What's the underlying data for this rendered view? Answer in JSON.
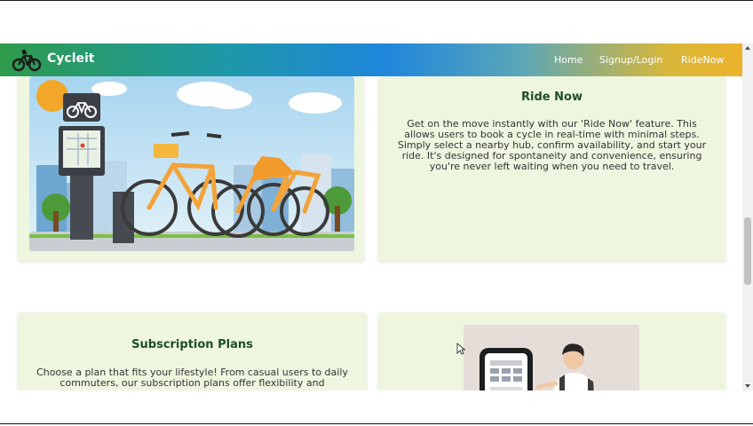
{
  "navbar": {
    "brand": "Cycleit",
    "brand_icon": "bicycle-icon",
    "links": [
      {
        "label": "Home"
      },
      {
        "label": "Signup/Login"
      },
      {
        "label": "RideNow"
      }
    ]
  },
  "cards": {
    "ride_now": {
      "title": "Ride Now",
      "image_icon": "bicycle-icon",
      "description": "Get on the move instantly with our 'Ride Now' feature. This allows users to book a cycle in real-time with minimal steps. Simply select a nearby hub, confirm availability, and start your ride. It's designed for spontaneity and convenience, ensuring you're never left waiting when you need to travel."
    },
    "subscription": {
      "title": "Subscription Plans",
      "description": "Choose a plan that fits your lifestyle! From casual users to daily commuters, our subscription plans offer flexibility and"
    }
  },
  "colors": {
    "card_bg": "#eef6df",
    "title_color": "#1f4d2a",
    "nav_gradient_start": "#2e9b4a",
    "nav_gradient_mid": "#1f86dc",
    "nav_gradient_end": "#edb32a"
  }
}
